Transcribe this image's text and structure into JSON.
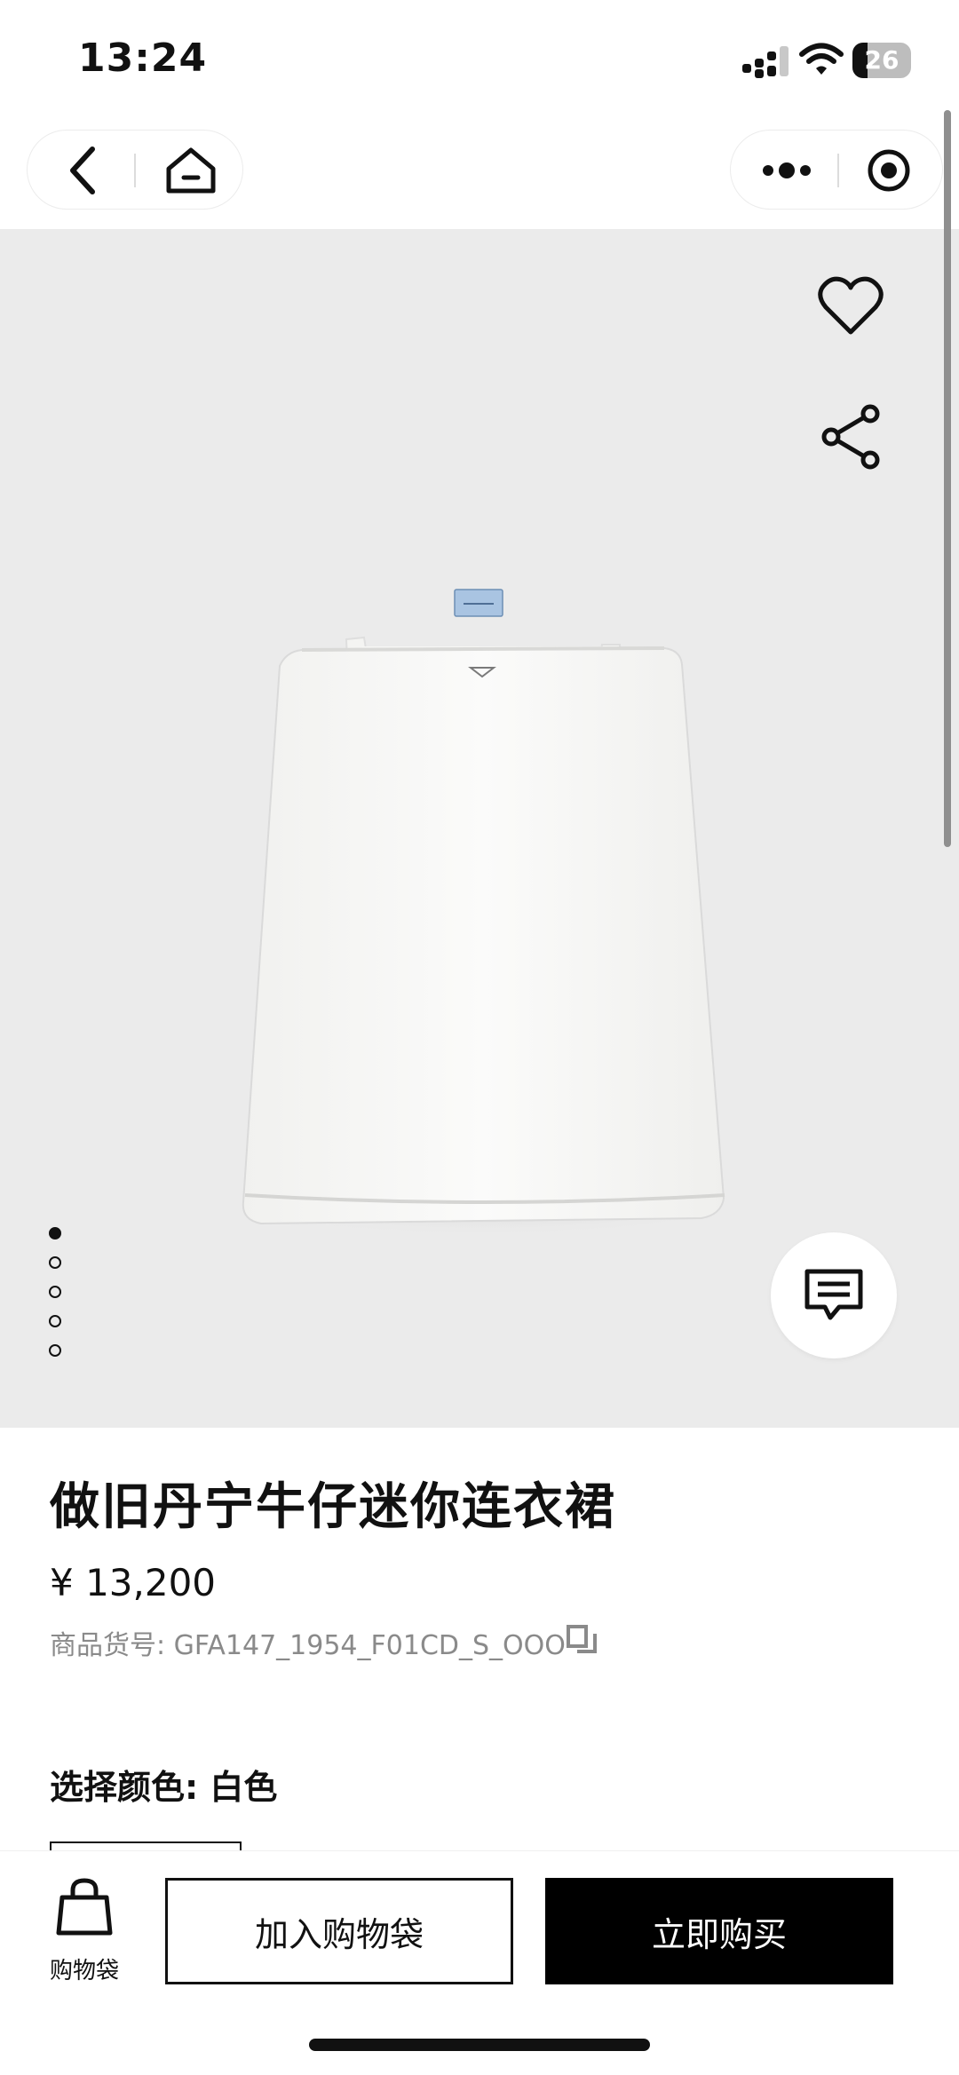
{
  "status_bar": {
    "time": "13:24",
    "battery_level": "26",
    "battery_fraction": 0.26
  },
  "nav": {
    "left_icons": [
      "back-icon",
      "home-icon"
    ],
    "right_icons": [
      "more-icon",
      "close-miniprogram-icon"
    ]
  },
  "gallery": {
    "image_count": 5,
    "active_index": 0,
    "icons": [
      "heart-icon",
      "share-icon",
      "chat-icon"
    ],
    "background_color": "#ebebeb"
  },
  "product": {
    "title": "做旧丹宁牛仔迷你连衣裙",
    "price": "¥ 13,200",
    "sku_label": "商品货号: GFA147_1954_F01CD_S_OOO",
    "color_label": "选择颜色: 白色"
  },
  "bottom_bar": {
    "bag_label": "购物袋",
    "add_to_bag": "加入购物袋",
    "buy_now": "立即购买"
  }
}
